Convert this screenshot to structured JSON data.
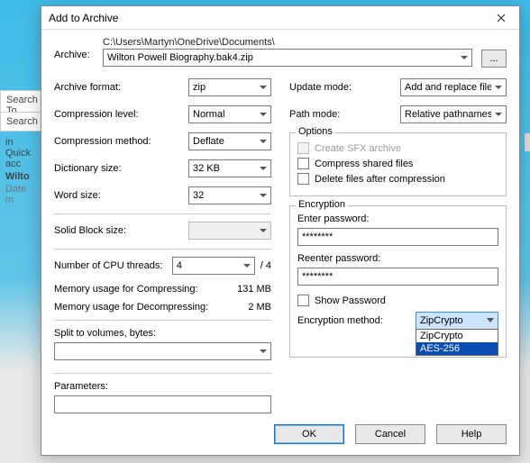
{
  "bg": {
    "search_tools": "Search To",
    "search": "Search",
    "quick_access": "in Quick acc",
    "file_name": "Wilto",
    "date_m": "Date m"
  },
  "dialog": {
    "title": "Add to Archive",
    "archive_label": "Archive:",
    "archive_dir": "C:\\Users\\Martyn\\OneDrive\\Documents\\",
    "archive_file": "Wilton Powell Biography.bak4.zip",
    "browse": "...",
    "left": {
      "format_label": "Archive format:",
      "format_value": "zip",
      "level_label": "Compression level:",
      "level_value": "Normal",
      "method_label": "Compression method:",
      "method_value": "Deflate",
      "dict_label": "Dictionary size:",
      "dict_value": "32 KB",
      "word_label": "Word size:",
      "word_value": "32",
      "solid_label": "Solid Block size:",
      "solid_value": "",
      "threads_label": "Number of CPU threads:",
      "threads_value": "4",
      "threads_total": "/ 4",
      "mem_comp_label": "Memory usage for Compressing:",
      "mem_comp_value": "131 MB",
      "mem_decomp_label": "Memory usage for Decompressing:",
      "mem_decomp_value": "2 MB",
      "split_label": "Split to volumes, bytes:",
      "split_value": "",
      "params_label": "Parameters:",
      "params_value": ""
    },
    "right": {
      "update_label": "Update mode:",
      "update_value": "Add and replace files",
      "path_label": "Path mode:",
      "path_value": "Relative pathnames",
      "options_legend": "Options",
      "sfx": "Create SFX archive",
      "shared": "Compress shared files",
      "delete_after": "Delete files after compression",
      "enc_legend": "Encryption",
      "enter_pw": "Enter password:",
      "pw_value": "********",
      "reenter_pw": "Reenter password:",
      "pw2_value": "********",
      "show_pw": "Show Password",
      "enc_method_label": "Encryption method:",
      "enc_method_value": "ZipCrypto",
      "enc_options": [
        "ZipCrypto",
        "AES-256"
      ]
    },
    "buttons": {
      "ok": "OK",
      "cancel": "Cancel",
      "help": "Help"
    }
  }
}
